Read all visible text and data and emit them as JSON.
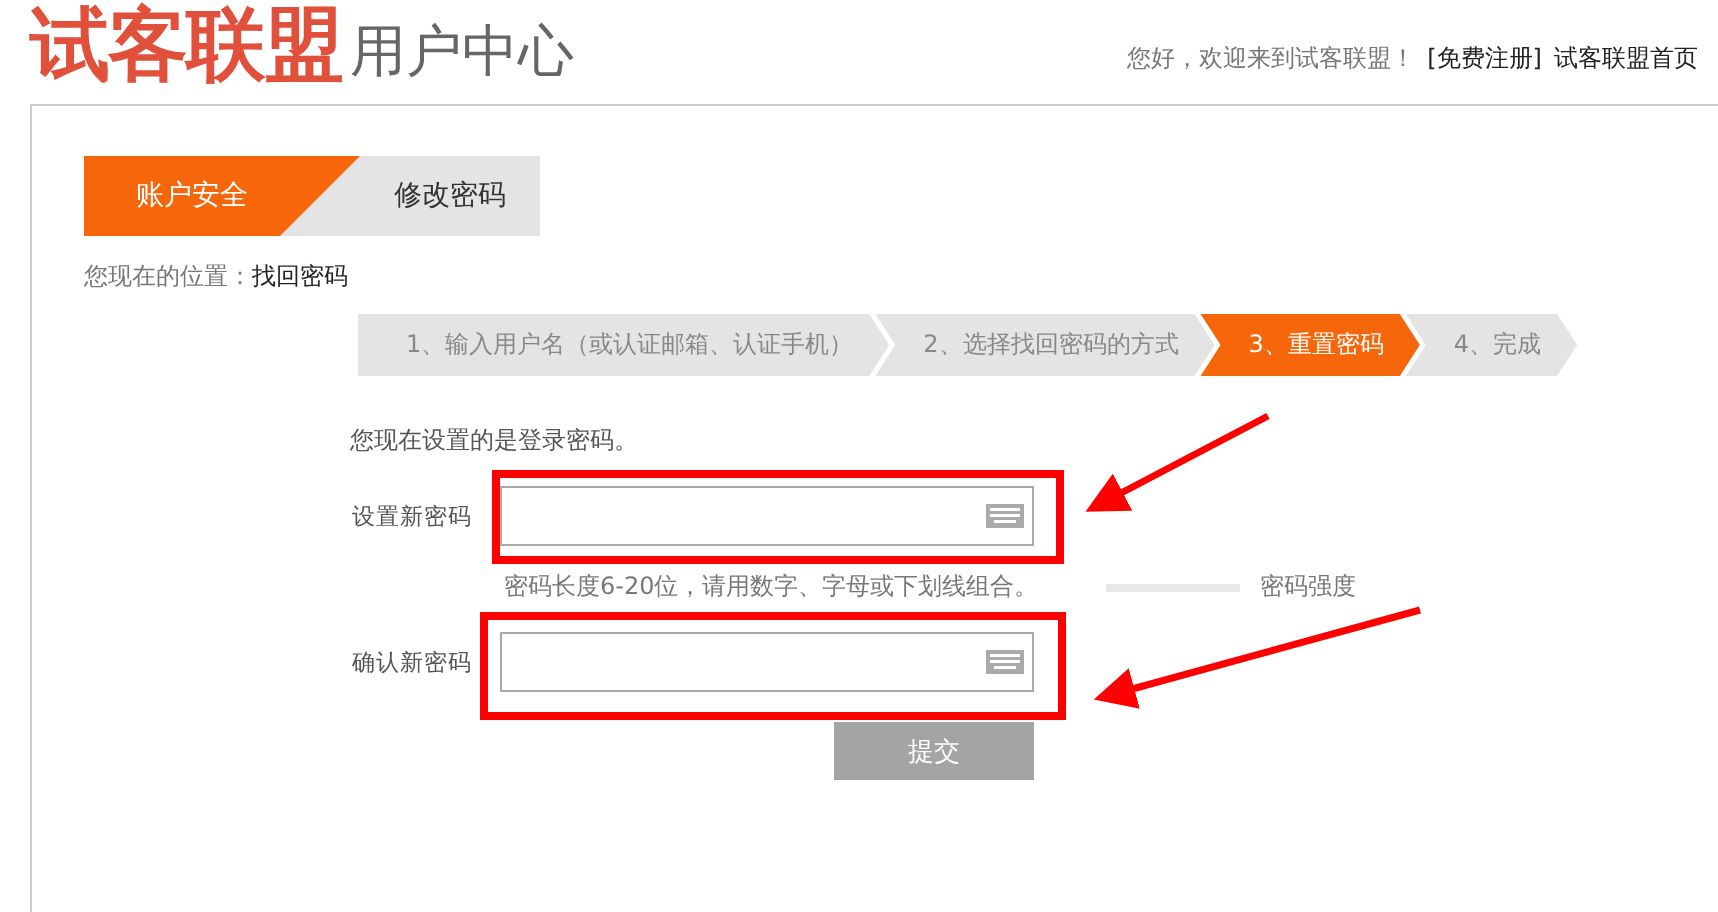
{
  "header": {
    "logo": "试客联盟",
    "subtitle": "用户中心",
    "greeting": "您好，欢迎来到试客联盟！",
    "links": [
      "[免费注册]",
      "试客联盟首页"
    ]
  },
  "tabs": [
    {
      "label": "账户安全",
      "selected": true
    },
    {
      "label": "修改密码",
      "selected": false
    }
  ],
  "breadcrumb": {
    "label": "您现在的位置：",
    "current": "找回密码"
  },
  "steps": [
    {
      "label": "1、输入用户名（或认证邮箱、认证手机）",
      "selected": false
    },
    {
      "label": "2、选择找回密码的方式",
      "selected": false
    },
    {
      "label": "3、重置密码",
      "selected": true
    },
    {
      "label": "4、完成",
      "selected": false
    }
  ],
  "form": {
    "note": "您现在设置的是登录密码。",
    "fields": [
      {
        "label": "设置新密码",
        "hint": "密码长度6-20位，请用数字、字母或下划线组合。",
        "strength": {
          "label": "密码强度"
        }
      },
      {
        "label": "确认新密码"
      }
    ],
    "submit": "提交"
  }
}
